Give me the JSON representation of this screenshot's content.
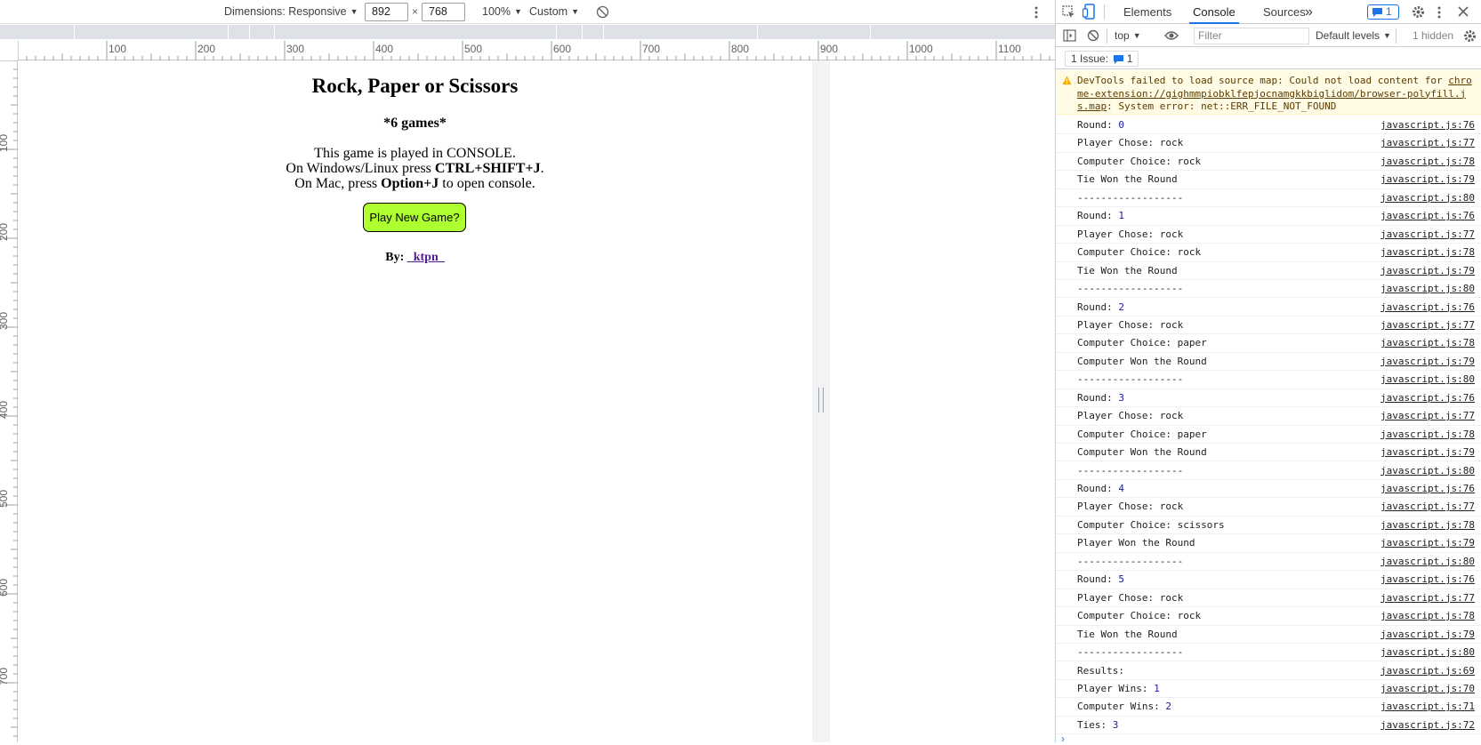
{
  "device_toolbar": {
    "dimensions_label": "Dimensions: Responsive",
    "width": "892",
    "times": "×",
    "height": "768",
    "zoom": "100%",
    "throttle": "Custom"
  },
  "rulers": {
    "top": [
      "100",
      "200",
      "300",
      "400",
      "500",
      "600",
      "700",
      "800",
      "900",
      "1000",
      "1100"
    ],
    "left": [
      "100",
      "200",
      "300",
      "400",
      "500",
      "600",
      "700"
    ]
  },
  "page": {
    "title": "Rock, Paper or Scissors",
    "games": "*6 games*",
    "line1": "This game is played in CONSOLE.",
    "line2_pre": "On Windows/Linux press ",
    "line2_key": "CTRL+SHIFT+J",
    "line2_post": ".",
    "line3_pre": "On Mac, press ",
    "line3_key": "Option+J",
    "line3_post": " to open console.",
    "button": "Play New Game?",
    "by_label": "By: ",
    "author": "_ktpn_",
    "button_color": "#adff2f",
    "link_color": "#551a8b"
  },
  "devtools": {
    "tabs": [
      "Elements",
      "Console",
      "Sources"
    ],
    "active_tab": "Console",
    "more_tabs": "»",
    "issues_badge": "1",
    "context": "top",
    "filter_placeholder": "Filter",
    "levels": "Default levels",
    "hidden": "1 hidden",
    "issues_label": "1 Issue:",
    "issues_count": "1",
    "warning": {
      "text_pre": "DevTools failed to load source map: Could not load content for ",
      "link": "chrome-extension://gighmmpiobklfepjocnamgkkbiglidom/browser-polyfill.js.map",
      "text_post": ": System error: net::ERR_FILE_NOT_FOUND"
    },
    "logs": [
      {
        "text": "Round: ",
        "num": "0",
        "src": "javascript.js:76"
      },
      {
        "text": "Player Chose: rock",
        "num": "",
        "src": "javascript.js:77"
      },
      {
        "text": "Computer Choice: rock",
        "num": "",
        "src": "javascript.js:78"
      },
      {
        "text": "Tie Won the Round",
        "num": "",
        "src": "javascript.js:79"
      },
      {
        "text": "------------------",
        "num": "",
        "src": "javascript.js:80"
      },
      {
        "text": "Round: ",
        "num": "1",
        "src": "javascript.js:76"
      },
      {
        "text": "Player Chose: rock",
        "num": "",
        "src": "javascript.js:77"
      },
      {
        "text": "Computer Choice: rock",
        "num": "",
        "src": "javascript.js:78"
      },
      {
        "text": "Tie Won the Round",
        "num": "",
        "src": "javascript.js:79"
      },
      {
        "text": "------------------",
        "num": "",
        "src": "javascript.js:80"
      },
      {
        "text": "Round: ",
        "num": "2",
        "src": "javascript.js:76"
      },
      {
        "text": "Player Chose: rock",
        "num": "",
        "src": "javascript.js:77"
      },
      {
        "text": "Computer Choice: paper",
        "num": "",
        "src": "javascript.js:78"
      },
      {
        "text": "Computer Won the Round",
        "num": "",
        "src": "javascript.js:79"
      },
      {
        "text": "------------------",
        "num": "",
        "src": "javascript.js:80"
      },
      {
        "text": "Round: ",
        "num": "3",
        "src": "javascript.js:76"
      },
      {
        "text": "Player Chose: rock",
        "num": "",
        "src": "javascript.js:77"
      },
      {
        "text": "Computer Choice: paper",
        "num": "",
        "src": "javascript.js:78"
      },
      {
        "text": "Computer Won the Round",
        "num": "",
        "src": "javascript.js:79"
      },
      {
        "text": "------------------",
        "num": "",
        "src": "javascript.js:80"
      },
      {
        "text": "Round: ",
        "num": "4",
        "src": "javascript.js:76"
      },
      {
        "text": "Player Chose: rock",
        "num": "",
        "src": "javascript.js:77"
      },
      {
        "text": "Computer Choice: scissors",
        "num": "",
        "src": "javascript.js:78"
      },
      {
        "text": "Player Won the Round",
        "num": "",
        "src": "javascript.js:79"
      },
      {
        "text": "------------------",
        "num": "",
        "src": "javascript.js:80"
      },
      {
        "text": "Round: ",
        "num": "5",
        "src": "javascript.js:76"
      },
      {
        "text": "Player Chose: rock",
        "num": "",
        "src": "javascript.js:77"
      },
      {
        "text": "Computer Choice: rock",
        "num": "",
        "src": "javascript.js:78"
      },
      {
        "text": "Tie Won the Round",
        "num": "",
        "src": "javascript.js:79"
      },
      {
        "text": "------------------",
        "num": "",
        "src": "javascript.js:80"
      },
      {
        "text": "Results:",
        "num": "",
        "src": "javascript.js:69"
      },
      {
        "text": "Player Wins: ",
        "num": "1",
        "src": "javascript.js:70"
      },
      {
        "text": "Computer Wins: ",
        "num": "2",
        "src": "javascript.js:71"
      },
      {
        "text": "Ties: ",
        "num": "3",
        "src": "javascript.js:72"
      }
    ],
    "prompt": "›"
  }
}
